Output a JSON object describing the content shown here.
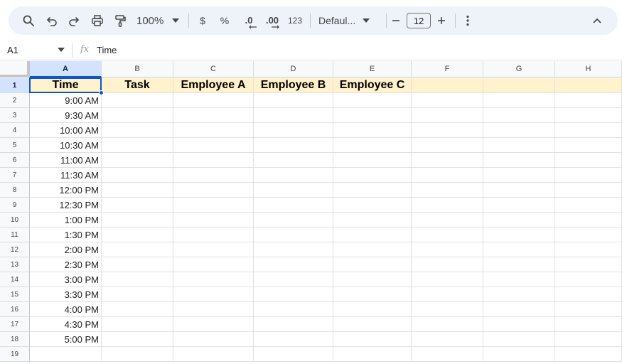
{
  "toolbar": {
    "zoom": "100%",
    "currency": "$",
    "percent": "%",
    "decrease_decimal": ".0",
    "increase_decimal": ".00",
    "number_format": "123",
    "font": "Defaul...",
    "font_size": "12",
    "icons": [
      "search-icon",
      "undo-icon",
      "redo-icon",
      "print-icon",
      "paint-format-icon",
      "minus-icon",
      "plus-icon",
      "more-vert-icon",
      "chevron-up-icon"
    ]
  },
  "formula_bar": {
    "cell_ref": "A1",
    "fx": "fx",
    "value": "Time"
  },
  "grid": {
    "columns": [
      "A",
      "B",
      "C",
      "D",
      "E",
      "F",
      "G",
      "H"
    ],
    "rows": [
      "1",
      "2",
      "3",
      "4",
      "5",
      "6",
      "7",
      "8",
      "9",
      "10",
      "11",
      "12",
      "13",
      "14",
      "15",
      "16",
      "17",
      "18",
      "19"
    ],
    "header_row": [
      "Time",
      "Task",
      "Employee A",
      "Employee B",
      "Employee C",
      "",
      "",
      ""
    ],
    "times": [
      "9:00 AM",
      "9:30 AM",
      "10:00 AM",
      "10:30 AM",
      "11:00 AM",
      "11:30 AM",
      "12:00 PM",
      "12:30 PM",
      "1:00 PM",
      "1:30 PM",
      "2:00 PM",
      "2:30 PM",
      "3:00 PM",
      "3:30 PM",
      "4:00 PM",
      "4:30 PM",
      "5:00 PM",
      ""
    ],
    "selected_cell": "A1",
    "header_fill": "#fff2cc",
    "selection_color": "#0b57d0"
  }
}
